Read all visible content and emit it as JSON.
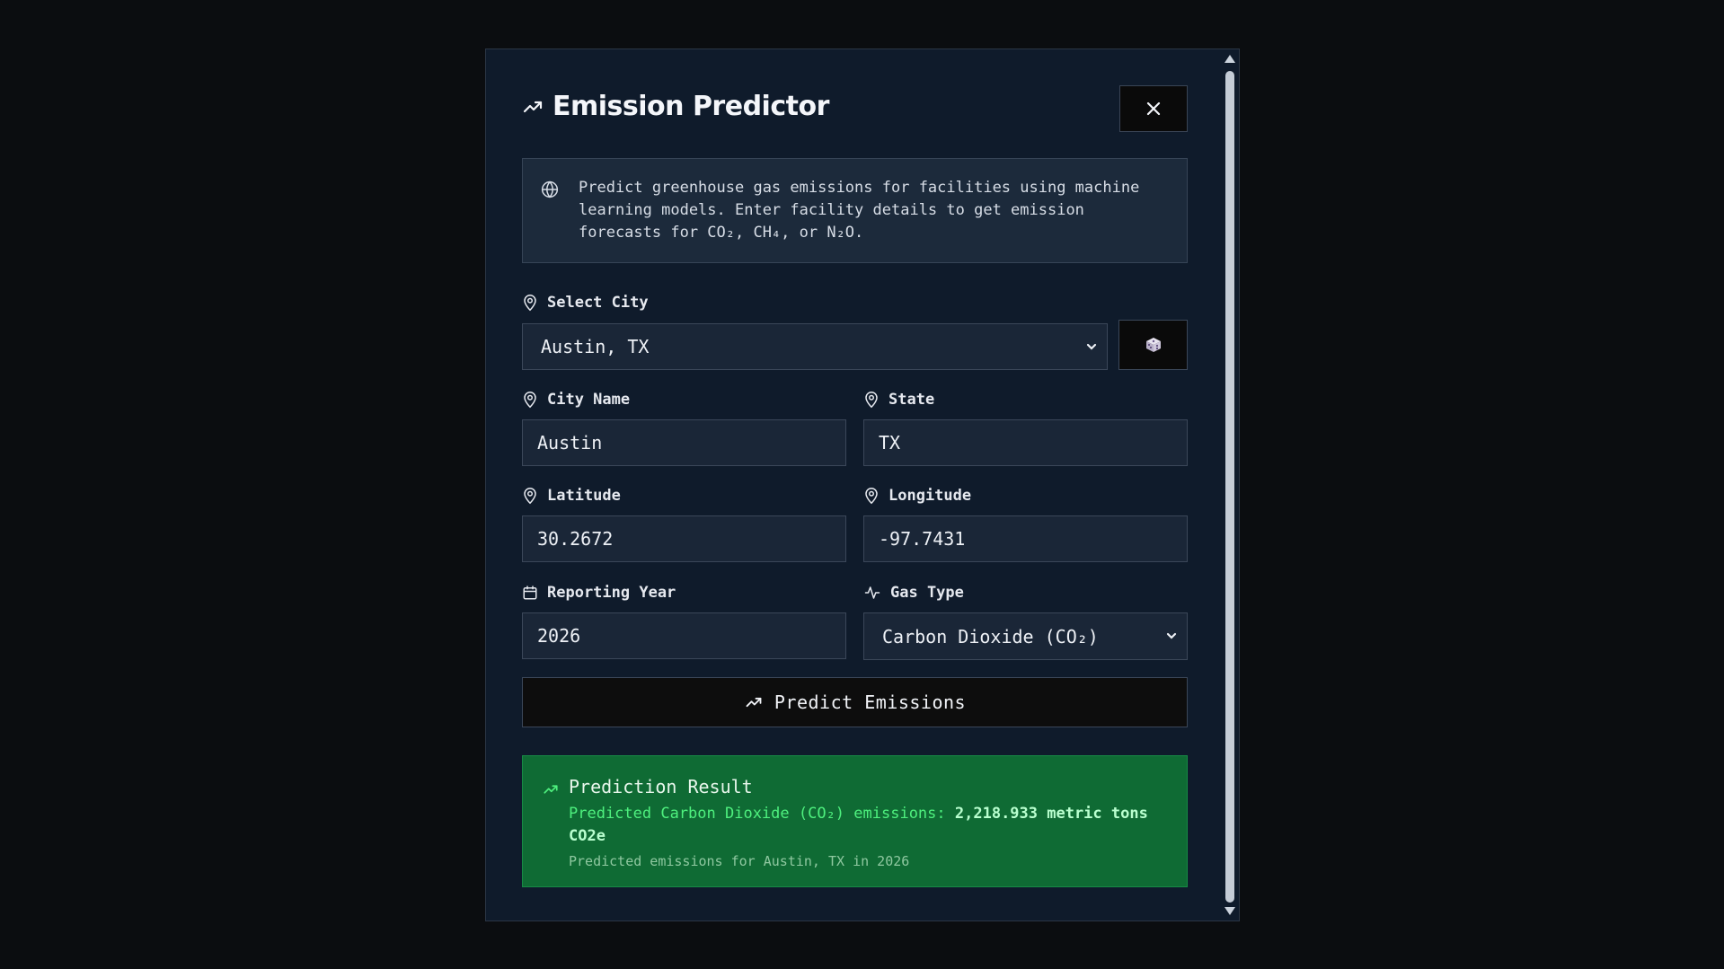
{
  "modal": {
    "title": "Emission Predictor",
    "close_icon": "close-icon",
    "info": "Predict greenhouse gas emissions for facilities using machine learning models. Enter facility details to get emission forecasts for CO₂, CH₄, or N₂O."
  },
  "form": {
    "select_city_label": "Select City",
    "select_city_value": "Austin, TX",
    "random_icon": "dice-icon",
    "city_name_label": "City Name",
    "city_name_value": "Austin",
    "state_label": "State",
    "state_value": "TX",
    "latitude_label": "Latitude",
    "latitude_value": "30.2672",
    "longitude_label": "Longitude",
    "longitude_value": "-97.7431",
    "year_label": "Reporting Year",
    "year_value": "2026",
    "gas_label": "Gas Type",
    "gas_value": "Carbon Dioxide (CO₂)",
    "predict_label": "Predict Emissions"
  },
  "result": {
    "title": "Prediction Result",
    "prefix": "Predicted Carbon Dioxide (CO₂) emissions:",
    "value": "2,218.933 metric tons CO2e",
    "sub": "Predicted emissions for Austin, TX in 2026"
  },
  "colors": {
    "background": "#0b0d10",
    "panel": "#0f1b2b",
    "field": "#1a2637",
    "result_bg": "#0f6b34",
    "result_text": "#4ef07e"
  }
}
